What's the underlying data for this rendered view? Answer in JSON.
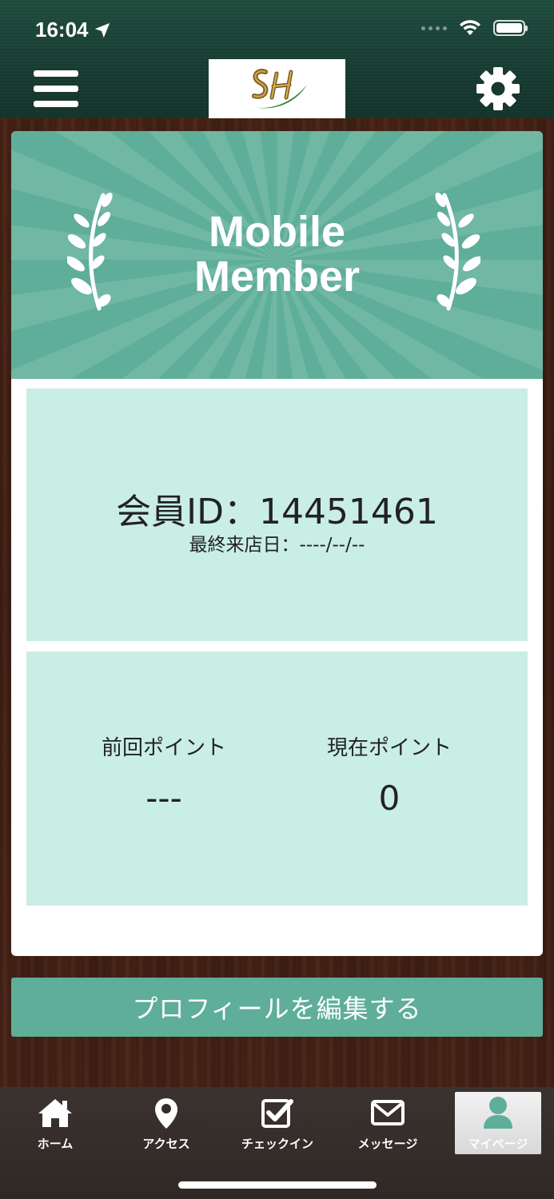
{
  "status_bar": {
    "time": "16:04"
  },
  "header": {
    "menu_icon": "hamburger-menu-icon",
    "logo_icon": "sh-monogram-logo",
    "settings_icon": "gear-icon"
  },
  "member_card": {
    "banner_title_line1": "Mobile",
    "banner_title_line2": "Member",
    "member_id_text": "会員ID：14451461",
    "last_visit_text": "最終来店日：----/--/--",
    "previous_points_label": "前回ポイント",
    "previous_points_value": "---",
    "current_points_label": "現在ポイント",
    "current_points_value": "0"
  },
  "edit_profile_label": "プロフィールを編集する",
  "tabbar": {
    "items": [
      {
        "label": "ホーム",
        "icon": "home-icon"
      },
      {
        "label": "アクセス",
        "icon": "map-pin-icon"
      },
      {
        "label": "チェックイン",
        "icon": "checkbox-icon"
      },
      {
        "label": "メッセージ",
        "icon": "envelope-icon"
      },
      {
        "label": "マイページ",
        "icon": "person-icon",
        "active": true
      }
    ]
  },
  "colors": {
    "accent": "#5eae99",
    "panel": "#c9eee5",
    "header": "#1e4d3f",
    "wood": "#4a2416"
  }
}
